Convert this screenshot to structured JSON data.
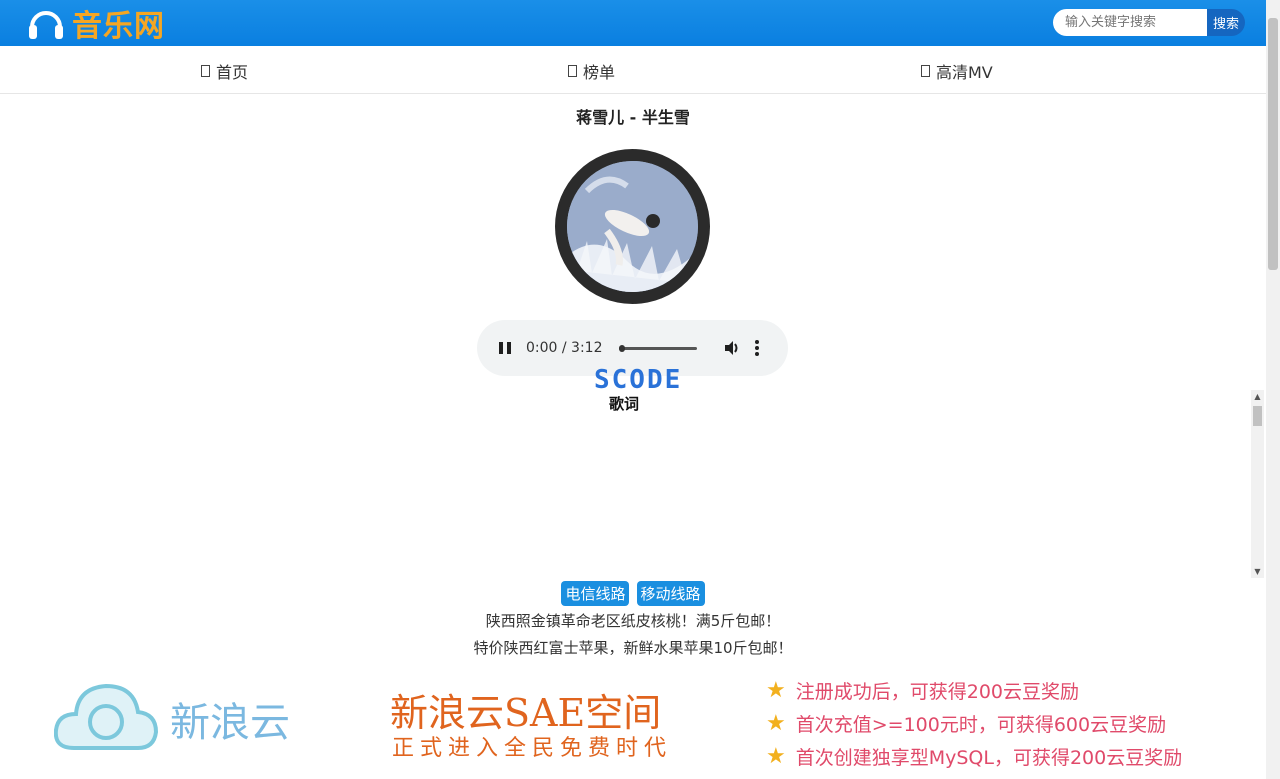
{
  "header": {
    "logo_text": "音乐网",
    "search_placeholder": "输入关键字搜索",
    "search_button": "搜索"
  },
  "nav": {
    "items": [
      {
        "label": "首页"
      },
      {
        "label": "榜单"
      },
      {
        "label": "高清MV"
      }
    ]
  },
  "player": {
    "song_title": "蒋雪儿 - 半生雪",
    "time": "0:00 / 3:12",
    "progress": 0,
    "watermark": "SCODE",
    "lyrics_label": "歌词"
  },
  "lines": {
    "telecom": "电信线路",
    "mobile": "移动线路"
  },
  "ads": {
    "line1": "陕西照金镇革命老区纸皮核桃！满5斤包邮！",
    "line2": "特价陕西红富士苹果，新鲜水果苹果10斤包邮！"
  },
  "banner": {
    "brand": "新浪云",
    "title": "新浪云SAE空间",
    "subtitle": "正式进入全民免费时代",
    "perks": [
      "注册成功后，可获得200云豆奖励",
      "首次充值>=100元时，可获得600云豆奖励",
      "首次创建独享型MySQL，可获得200云豆奖励"
    ]
  },
  "colors": {
    "topbar": "#0a7fe0",
    "accent": "#1a8fe0",
    "logo": "#f5a623",
    "promo": "#e0641e",
    "perk": "#e04a6a"
  }
}
